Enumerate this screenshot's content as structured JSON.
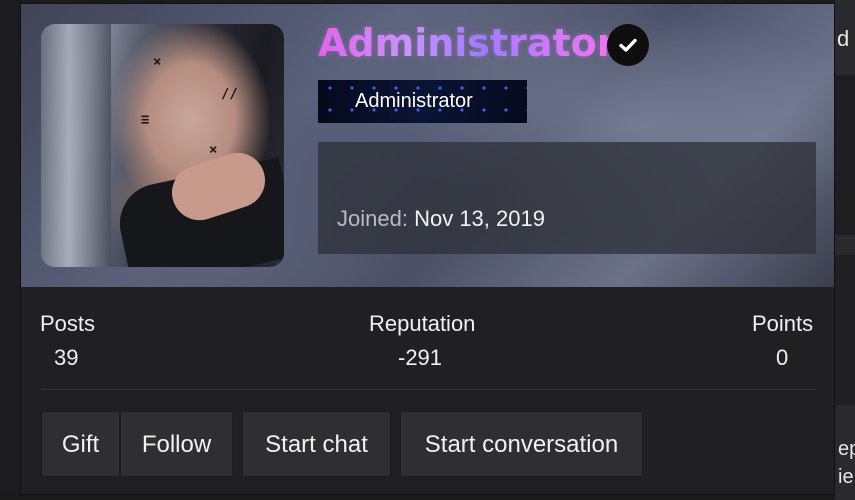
{
  "background": {
    "edge_text_top": "d",
    "edge_text_bottom_1": "ep",
    "edge_text_bottom_2": "ie"
  },
  "profile": {
    "username": "Administrator",
    "verified_icon": "verified-check-icon",
    "role_badge": "Administrator",
    "joined_label": "Joined:",
    "joined_date": "Nov 13, 2019"
  },
  "stats": {
    "posts_label": "Posts",
    "posts_value": "39",
    "reputation_label": "Reputation",
    "reputation_value": "-291",
    "points_label": "Points",
    "points_value": "0"
  },
  "actions": {
    "gift": "Gift",
    "follow": "Follow",
    "start_chat": "Start chat",
    "start_conversation": "Start conversation"
  },
  "colors": {
    "username_gradient": [
      "#e45de6",
      "#8f7dff",
      "#ff6fe6"
    ],
    "badge_bg": "#0a1434",
    "button_bg": "#2f2f31",
    "card_bg": "#202022"
  }
}
